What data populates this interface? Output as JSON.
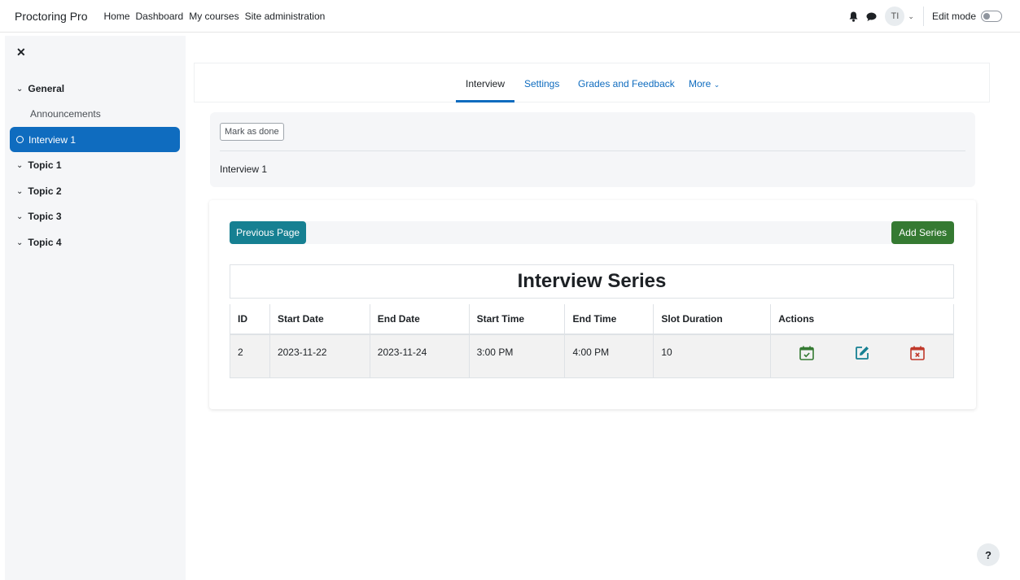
{
  "navbar": {
    "brand": "Proctoring Pro",
    "links": [
      "Home",
      "Dashboard",
      "My courses",
      "Site administration"
    ],
    "avatar_initials": "TI",
    "edit_mode_label": "Edit mode",
    "edit_mode_on": false
  },
  "sidebar": {
    "sections": [
      {
        "label": "General",
        "items": [
          "Announcements",
          "Interview 1"
        ]
      },
      {
        "label": "Topic 1"
      },
      {
        "label": "Topic 2"
      },
      {
        "label": "Topic 3"
      },
      {
        "label": "Topic 4"
      }
    ],
    "active_item": "Interview 1"
  },
  "tabs": {
    "items": [
      "Interview",
      "Settings",
      "Grades and Feedback",
      "More"
    ],
    "active": "Interview"
  },
  "activity": {
    "mark_done_label": "Mark as done",
    "name": "Interview 1"
  },
  "main": {
    "previous_label": "Previous Page",
    "add_label": "Add Series",
    "table_title": "Interview Series",
    "columns": [
      "ID",
      "Start Date",
      "End Date",
      "Start Time",
      "End Time",
      "Slot Duration",
      "Actions"
    ],
    "rows": [
      {
        "id": "2",
        "start_date": "2023-11-22",
        "end_date": "2023-11-24",
        "start_time": "3:00 PM",
        "end_time": "4:00 PM",
        "slot_duration": "10"
      }
    ]
  },
  "help_label": "?",
  "colors": {
    "primary": "#0f6cbf",
    "teal_button": "#168092",
    "green_button": "#357a32",
    "delete_red": "#c0392b"
  }
}
